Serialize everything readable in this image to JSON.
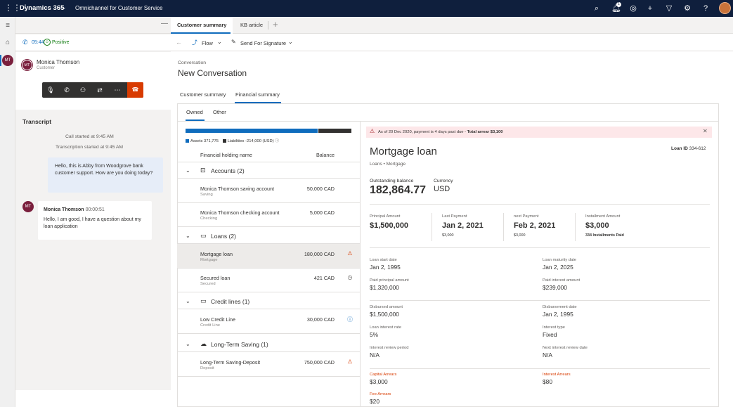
{
  "topbar": {
    "brand": "Dynamics 365",
    "app": "Omnichannel for Customer Service",
    "notification_count": "1"
  },
  "conversation": {
    "call_time": "05:44",
    "sentiment": "Positive",
    "customer_initials": "MT",
    "customer_name": "Monica Thomson",
    "customer_role": "Customer",
    "transcript_title": "Transcript",
    "system_lines": [
      "Call started at 9:45 AM",
      "Transcription started at 9:45 AM"
    ],
    "agent_message": "Hello, this is Abby from Woodgrove bank customer support. How are you doing today?",
    "customer_message_name": "Monica Thomson",
    "customer_message_time": "00:00:51",
    "customer_message": "Hello, I am good, I have a question about my loan application"
  },
  "tabs": {
    "customer_summary": "Customer summary",
    "kb_article": "KB article"
  },
  "commands": {
    "flow": "Flow",
    "send_for_signature": "Send For Signature"
  },
  "main": {
    "entity": "Conversation",
    "title": "New Conversation",
    "subtabs": [
      "Customer summary",
      "Financial summary"
    ],
    "inner_tabs": [
      "Owned",
      "Other"
    ]
  },
  "holdings": {
    "assets_label": "Assets 371,775",
    "liabilities_label": "Liabilities -214,000 (USD)",
    "assets_fraction": 0.8,
    "col_name": "Financial holding name",
    "col_balance": "Balance",
    "groups": [
      {
        "label": "Accounts (2)",
        "items": [
          {
            "name": "Monica Thomson saving account",
            "sub": "Saving",
            "balance": "50,000 CAD",
            "icon": ""
          },
          {
            "name": "Monica Thomson checking account",
            "sub": "Checking",
            "balance": "5,000 CAD",
            "icon": ""
          }
        ]
      },
      {
        "label": "Loans (2)",
        "items": [
          {
            "name": "Mortgage loan",
            "sub": "Mortgage",
            "balance": "180,000 CAD",
            "icon": "warning-icon"
          },
          {
            "name": "Secured loan",
            "sub": "Secured",
            "balance": "421 CAD",
            "icon": "clock-icon"
          }
        ]
      },
      {
        "label": "Credit lines (1)",
        "items": [
          {
            "name": "Low Credit Line",
            "sub": "Credit Line",
            "balance": "30,000 CAD",
            "icon": "info-icon"
          }
        ]
      },
      {
        "label": "Long-Term Saving (1)",
        "items": [
          {
            "name": "Long-Term Saving-Deposit",
            "sub": "Deposit",
            "balance": "750,000 CAD",
            "icon": "warning-icon"
          }
        ]
      }
    ]
  },
  "detail": {
    "alert_prefix": "As of 20 Dec 2020, payment is 4 days past due - ",
    "alert_bold": "Total arrear $3,100",
    "title": "Mortgage loan",
    "loan_id_label": "Loan ID",
    "loan_id": "334-612",
    "subtitle": "Loans • Mortgage",
    "outstanding_label": "Outstanding balance",
    "outstanding": "182,864.77",
    "currency_label": "Currency",
    "currency": "USD",
    "kpis": [
      {
        "label": "Principal Amount",
        "value": "$1,500,000",
        "sub": ""
      },
      {
        "label": "Last Payment",
        "value": "Jan 2, 2021",
        "sub": "$3,000"
      },
      {
        "label": "next Payment",
        "value": "Feb 2, 2021",
        "sub": "$3,000"
      },
      {
        "label": "Installment Amount",
        "value": "$3,000",
        "sub": "334 Installments Paid"
      }
    ],
    "fields": [
      {
        "label": "Loan start date",
        "value": "Jan 2, 1995"
      },
      {
        "label": "Loan maturity date",
        "value": "Jan 2, 2025"
      },
      {
        "label": "Paid principal amount",
        "value": "$1,320,000"
      },
      {
        "label": "Paid interest amount",
        "value": "$239,000"
      },
      {
        "label": "Disbursed amount",
        "value": "$1,500,000"
      },
      {
        "label": "Disbursement date",
        "value": "Jan 2, 1995"
      },
      {
        "label": "Loan interest rate",
        "value": "5%"
      },
      {
        "label": "Interest type",
        "value": "Fixed"
      },
      {
        "label": "Interest review period",
        "value": "N/A"
      },
      {
        "label": "Next interest review date",
        "value": "N/A"
      },
      {
        "label": "Capital Arrears",
        "value": "$3,000"
      },
      {
        "label": "Interest Arrears",
        "value": "$80"
      },
      {
        "label": "Fee Arrears",
        "value": "$20"
      }
    ]
  },
  "colors": {
    "brand_bar": "#0f1f3d",
    "accent": "#0f6cbd",
    "end_call": "#d83b01",
    "alert_bg": "#fde7e9",
    "warning": "#d83b01"
  }
}
